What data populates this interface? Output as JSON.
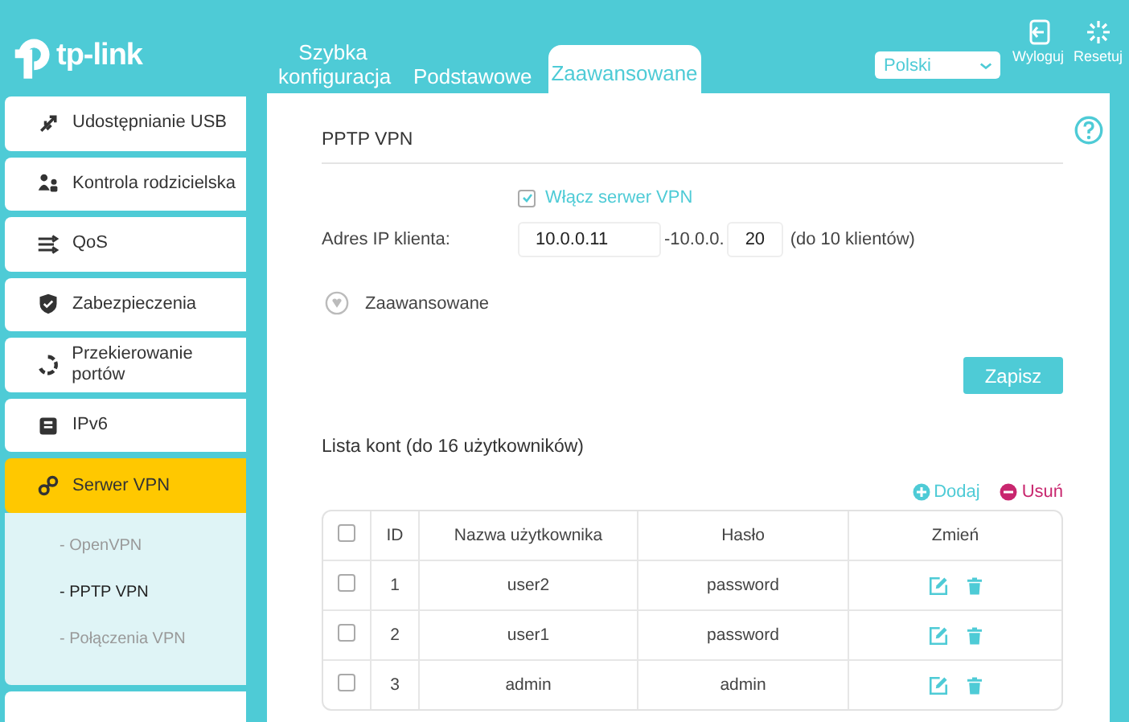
{
  "header": {
    "logo": "tp-link",
    "tabs": [
      {
        "label": "Szybka konfiguracja",
        "selected": false
      },
      {
        "label": "Podstawowe",
        "selected": false
      },
      {
        "label": "Zaawansowane",
        "selected": true
      }
    ],
    "language": "Polski",
    "actions": [
      {
        "kind": "logout",
        "label": "Wyloguj"
      },
      {
        "kind": "reset",
        "label": "Resetuj"
      }
    ]
  },
  "sidebar": {
    "items": [
      {
        "kind": "usb",
        "label": "Udostępnianie USB",
        "selected": false
      },
      {
        "kind": "parental",
        "label": "Kontrola rodzicielska",
        "selected": false
      },
      {
        "kind": "qos",
        "label": "QoS",
        "selected": false
      },
      {
        "kind": "shield",
        "label": "Zabezpieczenia",
        "selected": false
      },
      {
        "kind": "forward",
        "label": "Przekierowanie portów",
        "selected": false
      },
      {
        "kind": "ipv6",
        "label": "IPv6",
        "selected": false
      },
      {
        "kind": "vpn",
        "label": "Serwer VPN",
        "selected": true,
        "expanded": true,
        "children": [
          {
            "label": "- OpenVPN",
            "selected": false
          },
          {
            "label": "- PPTP VPN",
            "selected": true
          },
          {
            "label": "- Połączenia VPN",
            "selected": false
          }
        ]
      }
    ]
  },
  "panel": {
    "title": "PPTP VPN",
    "enable": {
      "label": "Włącz serwer VPN",
      "checked": true
    },
    "client_ip": {
      "label": "Adres IP klienta:",
      "start": "10.0.0.11",
      "separator": "-10.0.0.",
      "end": "20",
      "note": "(do 10 klientów)"
    },
    "advanced": {
      "label": "Zaawansowane",
      "expanded": false
    },
    "save": "Zapisz",
    "accounts": {
      "title": "Lista kont (do 16 użytkowników)",
      "add": "Dodaj",
      "remove": "Usuń",
      "all_checked": false,
      "columns": [
        "ID",
        "Nazwa użytkownika",
        "Hasło",
        "Zmień"
      ],
      "rows": [
        {
          "checked": false,
          "id": "1",
          "user": "user2",
          "password": "password"
        },
        {
          "checked": false,
          "id": "2",
          "user": "user1",
          "password": "password"
        },
        {
          "checked": false,
          "id": "3",
          "user": "admin",
          "password": "admin"
        }
      ]
    }
  }
}
